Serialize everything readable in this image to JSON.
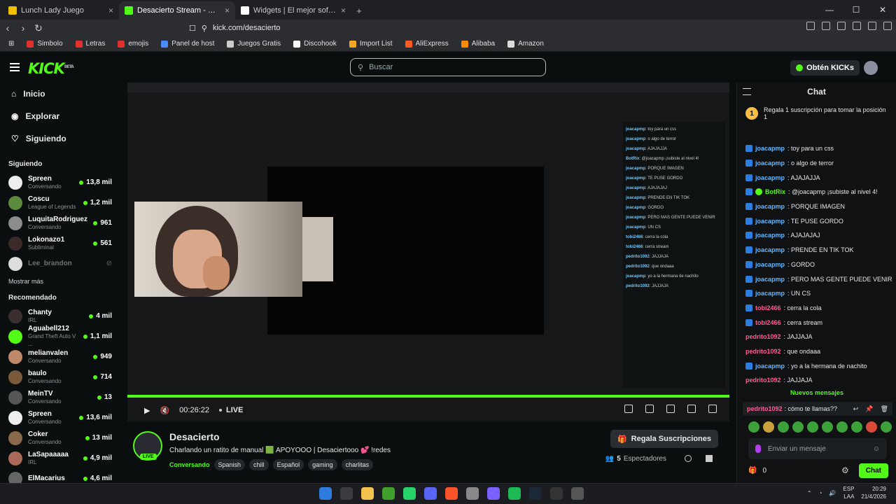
{
  "browser": {
    "tabs": [
      {
        "label": "Lunch Lady Juego",
        "active": false,
        "color": "#f0c000"
      },
      {
        "label": "Desacierto Stream - Watch Live",
        "active": true,
        "color": "#53fc18"
      },
      {
        "label": "Widgets | El mejor software para po",
        "active": false,
        "color": "#ffffff"
      }
    ],
    "url": "kick.com/desacierto",
    "bookmarks": [
      {
        "label": "Simbolo",
        "color": "#e0312d"
      },
      {
        "label": "Letras",
        "color": "#e0312d"
      },
      {
        "label": "emojis",
        "color": "#e0312d"
      },
      {
        "label": "Panel de host",
        "color": "#4a8cff"
      },
      {
        "label": "Juegos Gratis",
        "color": "#cccccc"
      },
      {
        "label": "Discohook",
        "color": "#ffffff"
      },
      {
        "label": "Import List",
        "color": "#f5a623"
      },
      {
        "label": "AliExpress",
        "color": "#ff5a1f"
      },
      {
        "label": "Alibaba",
        "color": "#ff8a00"
      },
      {
        "label": "Amazon",
        "color": "#dddddd"
      }
    ]
  },
  "header": {
    "logo": "KICK",
    "beta": "BETA",
    "search_placeholder": "Buscar",
    "kicks_button": "Obtén KICKs"
  },
  "sidebar": {
    "nav": [
      {
        "label": "Inicio",
        "icon": "home-icon"
      },
      {
        "label": "Explorar",
        "icon": "compass-icon"
      },
      {
        "label": "Siguiendo",
        "icon": "heart-icon"
      }
    ],
    "following_title": "Siguiendo",
    "following": [
      {
        "name": "Spreen",
        "sub": "Conversando",
        "viewers": "13,8 mil",
        "color": "#eeeeee"
      },
      {
        "name": "Coscu",
        "sub": "League of Legends",
        "viewers": "1,2 mil",
        "color": "#5c8b3f"
      },
      {
        "name": "LuquitaRodriguez",
        "sub": "Conversando",
        "viewers": "961",
        "color": "#8c8c8c"
      },
      {
        "name": "Lokonazo1",
        "sub": "Subliminal",
        "viewers": "561",
        "color": "#3b2a2a"
      },
      {
        "name": "Lee_brandon",
        "sub": "",
        "viewers": "",
        "color": "#dddddd"
      }
    ],
    "show_more": "Mostrar más",
    "recommended_title": "Recomendado",
    "recommended": [
      {
        "name": "Chanty",
        "sub": "IRL",
        "viewers": "4 mil",
        "color": "#3a2e2e"
      },
      {
        "name": "Aguabell212",
        "sub": "Grand Theft Auto V ...",
        "viewers": "1,1 mil",
        "color": "#53fc18"
      },
      {
        "name": "melianvalen",
        "sub": "Conversando",
        "viewers": "949",
        "color": "#c08a6a"
      },
      {
        "name": "baulo",
        "sub": "Conversando",
        "viewers": "714",
        "color": "#7a5a3a"
      },
      {
        "name": "MeinTV",
        "sub": "Conversando",
        "viewers": "13",
        "color": "#555555"
      },
      {
        "name": "Spreen",
        "sub": "Conversando",
        "viewers": "13,6 mil",
        "color": "#eeeeee"
      },
      {
        "name": "Coker",
        "sub": "Conversando",
        "viewers": "13 mil",
        "color": "#8a6a4a"
      },
      {
        "name": "LaSapaaaaa",
        "sub": "IRL",
        "viewers": "4,9 mil",
        "color": "#aa6a5a"
      },
      {
        "name": "ElMacarius",
        "sub": "",
        "viewers": "4,6 mil",
        "color": "#666666"
      }
    ]
  },
  "player": {
    "time": "00:26:22",
    "live": "LIVE"
  },
  "stream": {
    "name": "Desacierto",
    "title": "Charlando un ratito de manual 🟩 APOYOOO | Desaciertooo 💕 !redes",
    "category": "Conversando",
    "tags": [
      "Spanish",
      "chill",
      "Español",
      "gaming",
      "charlitas"
    ],
    "subscribe_button": "Regala Suscripciones",
    "viewer_count": "5",
    "viewer_label": "Espectadores",
    "live_badge": "LIVE"
  },
  "chat": {
    "title": "Chat",
    "gift_text": "Regala 1 suscripción para tomar la posición 1",
    "gift_rank": "1",
    "messages": [
      {
        "user": "joacapmp",
        "text": ": toy para un css",
        "kind": "blue"
      },
      {
        "user": "joacapmp",
        "text": ": o algo de terror",
        "kind": "blue"
      },
      {
        "user": "joacapmp",
        "text": ": AJAJAJJA",
        "kind": "blue"
      },
      {
        "user": "BotRix",
        "text": ": @joacapmp ¡subiste al nivel 4!",
        "kind": "green"
      },
      {
        "user": "joacapmp",
        "text": ": PORQUE IMAGEN",
        "kind": "blue"
      },
      {
        "user": "joacapmp",
        "text": ": TE PUSE GORDO",
        "kind": "blue"
      },
      {
        "user": "joacapmp",
        "text": ": AJAJAJAJ",
        "kind": "blue"
      },
      {
        "user": "joacapmp",
        "text": ": PRENDE EN TIK TOK",
        "kind": "blue"
      },
      {
        "user": "joacapmp",
        "text": ": GORDO",
        "kind": "blue"
      },
      {
        "user": "joacapmp",
        "text": ": PERO MAS GENTE PUEDE VENIR",
        "kind": "blue"
      },
      {
        "user": "joacapmp",
        "text": ": UN CS",
        "kind": "blue"
      },
      {
        "user": "tobi2466",
        "text": ": cerra la cola",
        "kind": "pink-badge"
      },
      {
        "user": "tobi2466",
        "text": ": cerra stream",
        "kind": "pink-badge"
      },
      {
        "user": "pedrito1092",
        "text": ": JAJJAJA",
        "kind": "pink"
      },
      {
        "user": "pedrito1092",
        "text": ": que ondaaa",
        "kind": "pink"
      },
      {
        "user": "joacapmp",
        "text": ": yo a la hermana de nachito",
        "kind": "blue"
      },
      {
        "user": "pedrito1092",
        "text": ": JAJJAJA",
        "kind": "pink"
      }
    ],
    "new_messages": "Nuevos mensajes",
    "last_message": {
      "user": "pedrito1092",
      "text": ": cómo te llamas??"
    },
    "input_placeholder": "Enviar un mensaje",
    "count": "0",
    "send_button": "Chat"
  },
  "taskbar": {
    "lang": "ESP",
    "lang2": "LAA",
    "time": "20:29",
    "date": "21/4/2026"
  }
}
